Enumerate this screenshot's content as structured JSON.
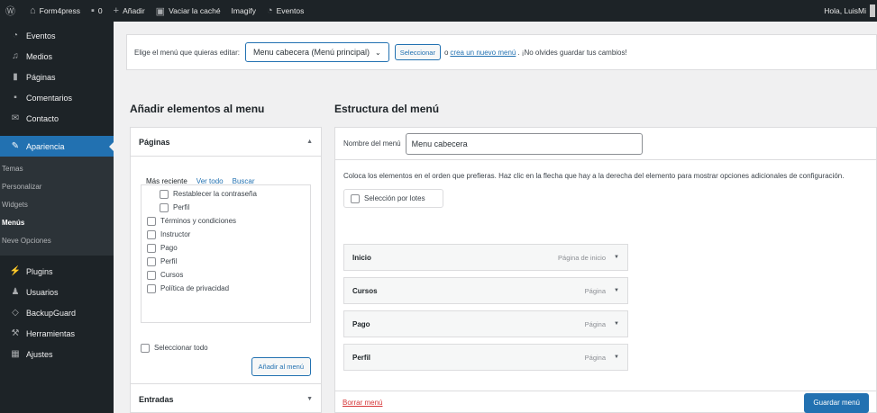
{
  "adminbar": {
    "site_name": "Form4press",
    "comments_count": "0",
    "new_label": "Añadir",
    "purge_cache": "Vaciar la caché",
    "imagify": "Imagify",
    "events": "Eventos",
    "greeting": "Hola, LuisMi"
  },
  "sidebar": {
    "items_top": [
      {
        "label": "Eventos",
        "icon": "calendar-icon"
      },
      {
        "label": "Medios",
        "icon": "media-icon"
      },
      {
        "label": "Páginas",
        "icon": "pages-icon"
      },
      {
        "label": "Comentarios",
        "icon": "comments-icon"
      },
      {
        "label": "Contacto",
        "icon": "mail-icon"
      }
    ],
    "active": {
      "label": "Apariencia",
      "icon": "paintbrush-icon"
    },
    "submenu": [
      "Temas",
      "Personalizar",
      "Widgets",
      "Menús",
      "Neve Opciones"
    ],
    "items_bottom": [
      {
        "label": "Plugins",
        "icon": "plugin-icon"
      },
      {
        "label": "Usuarios",
        "icon": "users-icon"
      },
      {
        "label": "BackupGuard",
        "icon": "shield-icon"
      },
      {
        "label": "Herramientas",
        "icon": "wrench-icon"
      },
      {
        "label": "Ajustes",
        "icon": "settings-icon"
      }
    ]
  },
  "select_bar": {
    "prompt": "Elige el menú que quieras editar:",
    "selected_menu": "Menu cabecera (Menú principal)",
    "select_button": "Seleccionar",
    "or_text": "o",
    "create_link": "crea un nuevo menú",
    "reminder": ". ¡No olvides guardar tus cambios!"
  },
  "left": {
    "heading": "Añadir elementos al menu",
    "pages_title": "Páginas",
    "tabs": [
      "Más reciente",
      "Ver todo",
      "Buscar"
    ],
    "pages": [
      {
        "label": "Restablecer la contraseña",
        "indent": true
      },
      {
        "label": "Perfil",
        "indent": true
      },
      {
        "label": "Términos y condiciones",
        "indent": false
      },
      {
        "label": "Instructor",
        "indent": false
      },
      {
        "label": "Pago",
        "indent": false
      },
      {
        "label": "Perfil",
        "indent": false
      },
      {
        "label": "Cursos",
        "indent": false
      },
      {
        "label": "Política de privacidad",
        "indent": false
      }
    ],
    "select_all": "Seleccionar todo",
    "add_button": "Añadir al menú",
    "posts_title": "Entradas"
  },
  "right": {
    "heading": "Estructura del menú",
    "name_label": "Nombre del menú",
    "name_value": "Menu cabecera",
    "instructions": "Coloca los elementos en el orden que prefieras. Haz clic en la flecha que hay a la derecha del elemento para mostrar opciones adicionales de configuración.",
    "bulk_select": "Selección por lotes",
    "menu_items": [
      {
        "title": "Inicio",
        "type": "Página de inicio"
      },
      {
        "title": "Cursos",
        "type": "Página"
      },
      {
        "title": "Pago",
        "type": "Página"
      },
      {
        "title": "Perfil",
        "type": "Página"
      }
    ],
    "delete_link": "Borrar menú",
    "save_button": "Guardar menú"
  }
}
